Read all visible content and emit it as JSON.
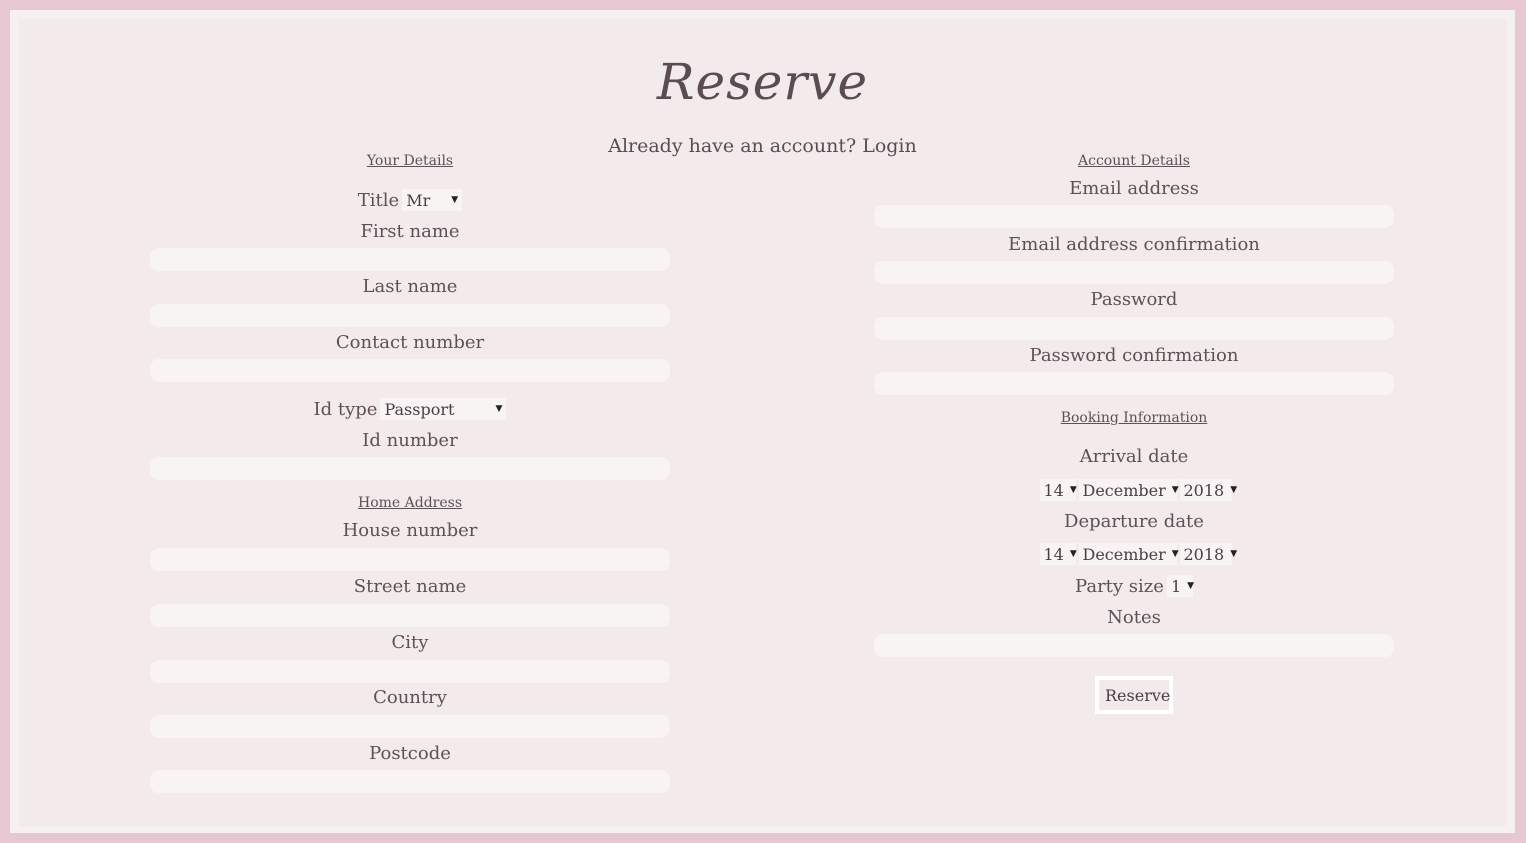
{
  "header": {
    "title": "Reserve",
    "login_prompt": "Already have an account?",
    "login_link": "Login"
  },
  "your_details": {
    "heading": "Your Details",
    "title_label": "Title",
    "title_value": "Mr",
    "first_name_label": "First name",
    "last_name_label": "Last name",
    "contact_label": "Contact number",
    "id_type_label": "Id type",
    "id_type_value": "Passport",
    "id_number_label": "Id number"
  },
  "home_address": {
    "heading": "Home Address",
    "house_label": "House number",
    "street_label": "Street name",
    "city_label": "City",
    "country_label": "Country",
    "postcode_label": "Postcode"
  },
  "account_details": {
    "heading": "Account Details",
    "email_label": "Email address",
    "email_confirm_label": "Email address confirmation",
    "password_label": "Password",
    "password_confirm_label": "Password confirmation"
  },
  "booking": {
    "heading": "Booking Information",
    "arrival_label": "Arrival date",
    "arrival_day": "14",
    "arrival_month": "December",
    "arrival_year": "2018",
    "departure_label": "Departure date",
    "departure_day": "14",
    "departure_month": "December",
    "departure_year": "2018",
    "party_label": "Party size",
    "party_value": "1",
    "notes_label": "Notes",
    "submit_label": "Reserve"
  }
}
